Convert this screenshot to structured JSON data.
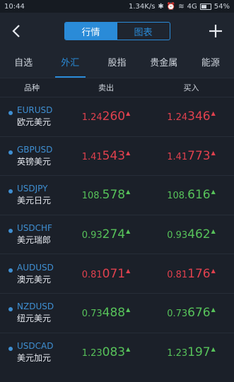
{
  "status": {
    "time": "10:44",
    "speed": "1.34K/s",
    "net": "4G",
    "battery": "54%"
  },
  "segment": {
    "left": "行情",
    "right": "图表"
  },
  "tabs": [
    "自选",
    "外汇",
    "股指",
    "贵金属",
    "能源"
  ],
  "table": {
    "h1": "品种",
    "h2": "卖出",
    "h3": "买入"
  },
  "rows": [
    {
      "code": "EURUSD",
      "name": "欧元美元",
      "sell_a": "1.24",
      "sell_b": "260",
      "buy_a": "1.24",
      "buy_b": "346",
      "sell_dir": "up",
      "buy_dir": "up",
      "sell_color": "red",
      "buy_color": "red"
    },
    {
      "code": "GBPUSD",
      "name": "英镑美元",
      "sell_a": "1.41",
      "sell_b": "543",
      "buy_a": "1.41",
      "buy_b": "773",
      "sell_dir": "up",
      "buy_dir": "up",
      "sell_color": "red",
      "buy_color": "red"
    },
    {
      "code": "USDJPY",
      "name": "美元日元",
      "sell_a": "108.",
      "sell_b": "578",
      "buy_a": "108.",
      "buy_b": "616",
      "sell_dir": "up",
      "buy_dir": "up",
      "sell_color": "green",
      "buy_color": "green"
    },
    {
      "code": "USDCHF",
      "name": "美元瑞郎",
      "sell_a": "0.93",
      "sell_b": "274",
      "buy_a": "0.93",
      "buy_b": "462",
      "sell_dir": "up",
      "buy_dir": "up",
      "sell_color": "green",
      "buy_color": "green"
    },
    {
      "code": "AUDUSD",
      "name": "澳元美元",
      "sell_a": "0.81",
      "sell_b": "071",
      "buy_a": "0.81",
      "buy_b": "176",
      "sell_dir": "up",
      "buy_dir": "up",
      "sell_color": "red",
      "buy_color": "red"
    },
    {
      "code": "NZDUSD",
      "name": "纽元美元",
      "sell_a": "0.73",
      "sell_b": "488",
      "buy_a": "0.73",
      "buy_b": "676",
      "sell_dir": "up",
      "buy_dir": "up",
      "sell_color": "green",
      "buy_color": "green"
    },
    {
      "code": "USDCAD",
      "name": "美元加元",
      "sell_a": "1.23",
      "sell_b": "083",
      "buy_a": "1.23",
      "buy_b": "197",
      "sell_dir": "up",
      "buy_dir": "up",
      "sell_color": "green",
      "buy_color": "green"
    }
  ],
  "colors": {
    "accent": "#2a8bd8",
    "up": "#e0414e",
    "down": "#57c25a",
    "bg": "#1b2029"
  },
  "icons": {
    "back": "back-icon",
    "add": "plus-icon"
  }
}
